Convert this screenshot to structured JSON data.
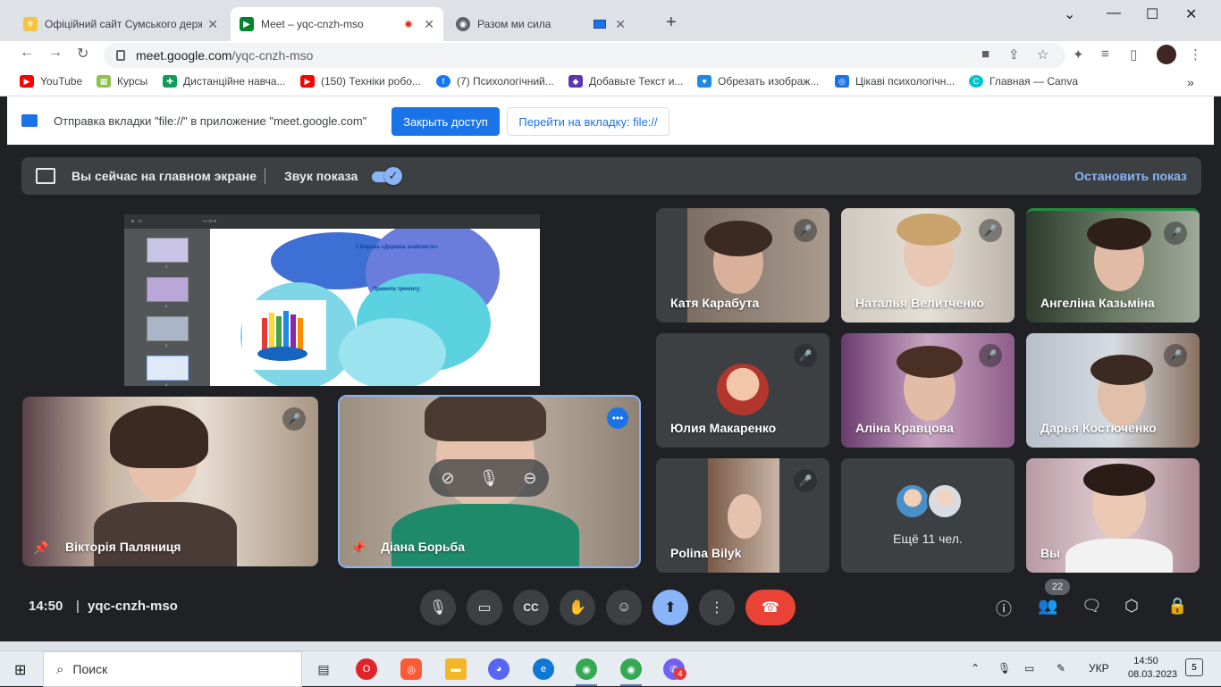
{
  "tabs": [
    {
      "title": "Офіційний сайт Сумського держ",
      "favicon": "crest-icon",
      "color": "#f5c542"
    },
    {
      "title": "Meet – yqc-cnzh-mso",
      "favicon": "meet-icon",
      "color": "#00832d",
      "recording": true
    },
    {
      "title": "Разом ми сила",
      "favicon": "globe-icon",
      "color": "#5f6368"
    }
  ],
  "omnibox": {
    "host": "meet.google.com",
    "path": "/yqc-cnzh-mso"
  },
  "bookmarks": [
    {
      "label": "YouTube",
      "icon": "youtube-icon",
      "color": "#ff0000"
    },
    {
      "label": "Курсы",
      "icon": "courses-icon",
      "color": "#4caf50"
    },
    {
      "label": "Дистанційне навча...",
      "icon": "classroom-icon",
      "color": "#0f9d58"
    },
    {
      "label": "(150) Техніки робо...",
      "icon": "youtube-icon",
      "color": "#ff0000"
    },
    {
      "label": "(7) Психологічний...",
      "icon": "facebook-icon",
      "color": "#1877f2"
    },
    {
      "label": "Добавьте Текст и...",
      "icon": "shield-icon",
      "color": "#5e35b1"
    },
    {
      "label": "Обрезать изображ...",
      "icon": "heart-icon",
      "color": "#1e88e5"
    },
    {
      "label": "Цікаві психологічн...",
      "icon": "circle-icon",
      "color": "#1a73e8"
    },
    {
      "label": "Главная — Canva",
      "icon": "canva-icon",
      "color": "#00c4cc"
    }
  ],
  "infobar": {
    "message": "Отправка вкладки \"file://\" в приложение \"meet.google.com\"",
    "stop_share_label": "Закрыть доступ",
    "switch_tab_label": "Перейти на вкладку: file://"
  },
  "present_bar": {
    "status": "Вы сейчас на главном экране",
    "sound_label": "Звук показа",
    "sound_on": true,
    "stop_label": "Остановить показ"
  },
  "shared_screen": {
    "page_title": "1.Вправа «Доріжка знайомств»",
    "rules_title": "Правила тренінгу:",
    "thumb_numbers": [
      "1",
      "2",
      "3",
      "4"
    ]
  },
  "participants": [
    {
      "name": "Вікторія Паляниця",
      "muted": true,
      "pinned": true
    },
    {
      "name": "Діана Борьба",
      "muted": false,
      "pinned": true,
      "selected": true
    },
    {
      "name": "Катя Карабута",
      "muted": true
    },
    {
      "name": "Наталья Велитченко",
      "muted": true
    },
    {
      "name": "Ангеліна Казьміна",
      "muted": true
    },
    {
      "name": "Юлия Макаренко",
      "muted": true
    },
    {
      "name": "Аліна Кравцова",
      "muted": true
    },
    {
      "name": "Дарья Костюченко",
      "muted": true
    },
    {
      "name": "Polina Bilyk",
      "muted": true
    },
    {
      "name": "Вы",
      "muted": false
    }
  ],
  "more_people": "Ещё 11 чел.",
  "meeting": {
    "time": "14:50",
    "code": "yqc-cnzh-mso",
    "people_count": "22"
  },
  "taskbar": {
    "search_label": "Поиск",
    "lang": "УКР",
    "time": "14:50",
    "date": "08.03.2023",
    "notifications": "5",
    "viber_badge": "4"
  },
  "colors": {
    "accent": "#8ab4f8",
    "end_call": "#ea4335",
    "meet_bg": "#202124",
    "tile_bg": "#3c4043"
  }
}
